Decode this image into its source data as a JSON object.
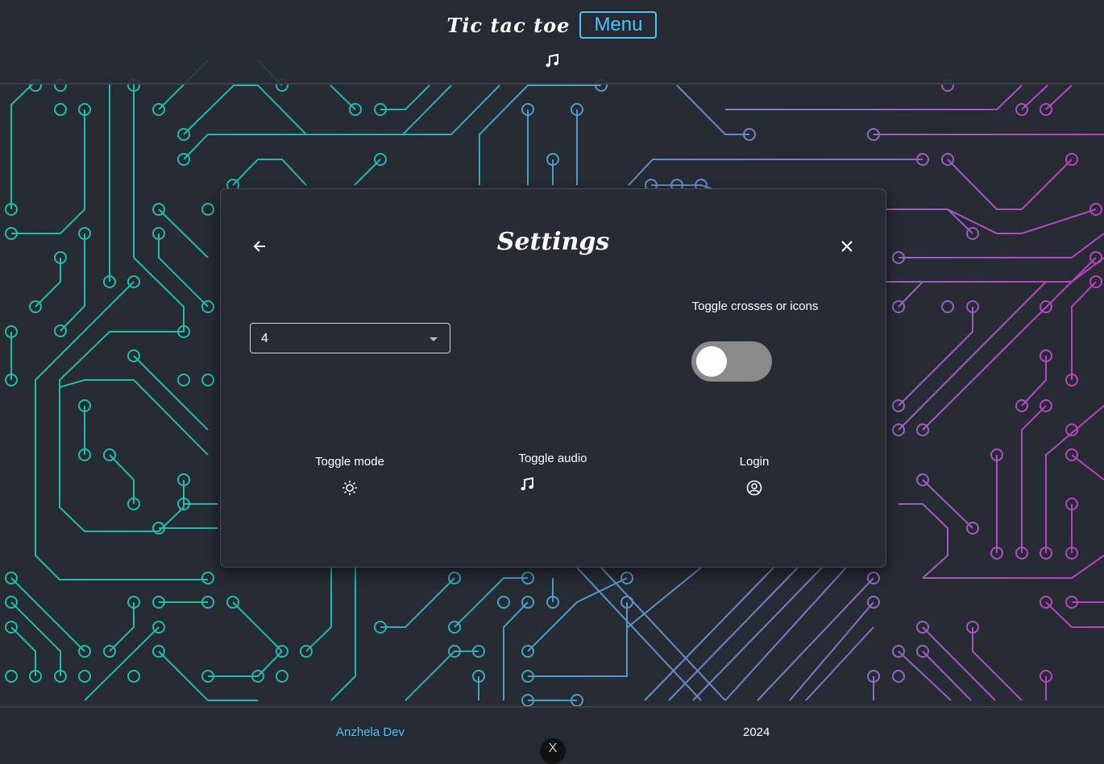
{
  "header": {
    "title": "Tic tac toe",
    "menu_label": "Menu",
    "audio_icon": "music-note-icon"
  },
  "settings_modal": {
    "title": "Settings",
    "back_icon": "arrow-left-icon",
    "close_icon": "close-icon",
    "grid_size_select": {
      "selected": "4"
    },
    "toggle_crosses": {
      "label": "Toggle crosses or icons",
      "checked": false
    },
    "actions": [
      {
        "label": "Toggle mode",
        "icon": "sun-icon"
      },
      {
        "label": "Toggle audio",
        "icon": "music-note-icon"
      },
      {
        "label": "Login",
        "icon": "user-circle-icon"
      }
    ]
  },
  "footer": {
    "developer": "Anzhela Dev",
    "year": "2024",
    "badge_glyph": "X"
  },
  "colors": {
    "background": "#272b33",
    "accent": "#4fc3f7",
    "circuit_teal": "#1fc0a8",
    "circuit_purple": "#7d7dc8",
    "circuit_magenta": "#c03cc0",
    "toggle_track": "#8a8a8a"
  }
}
